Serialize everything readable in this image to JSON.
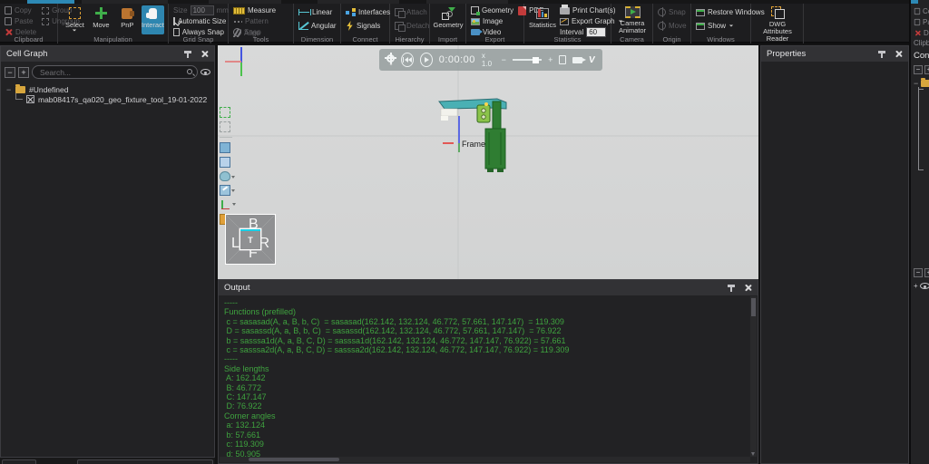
{
  "ribbon": {
    "clipboard": {
      "label": "Clipboard",
      "copy": "Copy",
      "paste": "Paste",
      "delete": "Delete",
      "group": "Group",
      "ungroup": "Ungroup"
    },
    "manipulation": {
      "label": "Manipulation",
      "select": "Select",
      "move": "Move",
      "pnp": "PnP",
      "interact": "Interact"
    },
    "grid_snap": {
      "label": "Grid Snap",
      "size_label": "Size",
      "size_value": "100",
      "size_unit": "mm",
      "automatic_size": "Automatic Size",
      "always_snap": "Always Snap"
    },
    "tools": {
      "label": "Tools",
      "measure": "Measure",
      "pattern": "Pattern",
      "snap": "Snap",
      "align": "Align"
    },
    "dimension": {
      "label": "Dimension",
      "linear": "Linear",
      "angular": "Angular"
    },
    "connect": {
      "label": "Connect",
      "interfaces": "Interfaces",
      "signals": "Signals"
    },
    "hierarchy": {
      "label": "Hierarchy",
      "attach": "Attach",
      "detach": "Detach"
    },
    "import": {
      "label": "Import",
      "geometry": "Geometry"
    },
    "export": {
      "label": "Export",
      "geometry": "Geometry",
      "pdf": "PDF",
      "image": "Image",
      "video": "Video"
    },
    "statistics": {
      "label": "Statistics",
      "statistics": "Statistics",
      "print_charts": "Print Chart(s)",
      "export_graph": "Export Graph",
      "interval_label": "Interval",
      "interval_value": "60"
    },
    "camera": {
      "label": "Camera",
      "camera_animator": "Camera Animator"
    },
    "origin": {
      "label": "Origin",
      "snap": "Snap",
      "move": "Move"
    },
    "windows": {
      "label": "Windows",
      "restore_windows": "Restore Windows",
      "show": "Show"
    },
    "dwg": {
      "label": "DWG Attributes Reader"
    }
  },
  "cell_graph": {
    "title": "Cell Graph",
    "search_placeholder": "Search...",
    "root_item": "#Undefined",
    "child_item": "mab08417s_qa020_geo_fixture_tool_19-01-2022"
  },
  "viewport": {
    "time": "0:00:00",
    "speed": "x  1.0",
    "frame_label": "Frame",
    "cube": {
      "back": "B",
      "left": "L",
      "top": "T",
      "right": "R",
      "front": "F"
    }
  },
  "properties": {
    "title": "Properties"
  },
  "output": {
    "title": "Output",
    "lines": [
      "-----",
      "Functions (prefilled)",
      " c = sasasad(A, a, B, b, C)  = sasasad(162.142, 132.124, 46.772, 57.661, 147.147)  = 119.309",
      " D = sasassd(A, a, B, b, C)  = sasassd(162.142, 132.124, 46.772, 57.661, 147.147)  = 76.922",
      " b = sasssa1d(A, a, B, C, D) = sasssa1d(162.142, 132.124, 46.772, 147.147, 76.922) = 57.661",
      " c = sasssa2d(A, a, B, C, D) = sasssa2d(162.142, 132.124, 46.772, 147.147, 76.922) = 119.309",
      "-----",
      "Side lengths",
      " A: 162.142",
      " B: 46.772",
      " C: 147.147",
      " D: 76.922",
      "Corner angles",
      " a: 132.124",
      " b: 57.661",
      " c: 119.309",
      " d: 50.905"
    ]
  },
  "right_edge": {
    "copy": "Co",
    "paste": "Pa",
    "delete": "De",
    "clipboard": "Clipb",
    "panel_title": "Con"
  },
  "colors": {
    "accent_blue": "#2e86b0",
    "console_green": "#3fa33f",
    "viewport_gray": "#d6d7d7",
    "beam_teal": "#4ab0b4",
    "model_green": "#2e7d32"
  }
}
